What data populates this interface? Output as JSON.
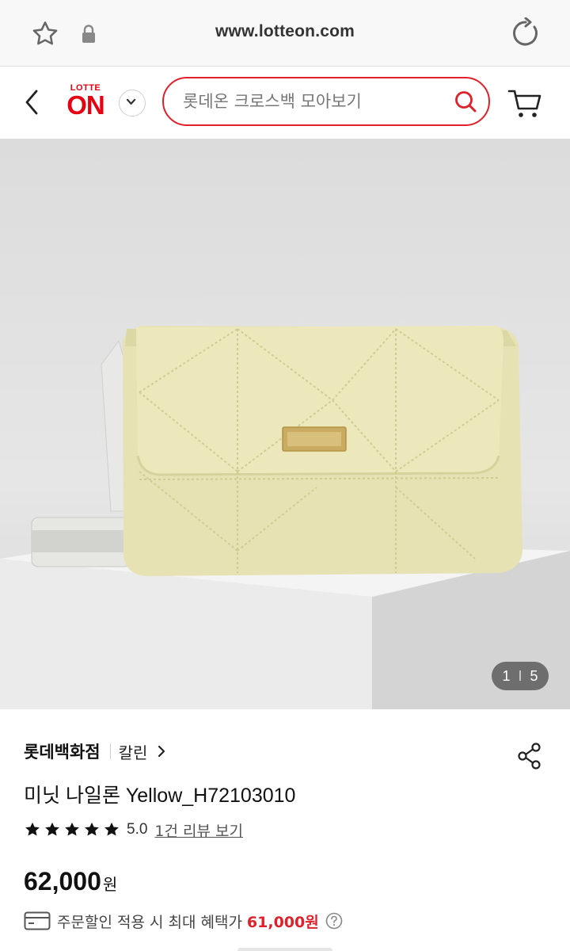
{
  "browser": {
    "url": "www.lotteon.com",
    "icons": [
      "star-icon",
      "lock-icon",
      "reload-icon"
    ]
  },
  "header": {
    "logo_top": "LOTTE",
    "logo_main": "ON",
    "search_placeholder": "롯데온 크로스백 모아보기",
    "accent_color": "#e0202a",
    "icons": [
      "back-icon",
      "chevron-down-icon",
      "search-icon",
      "cart-icon"
    ]
  },
  "product": {
    "image_counter": {
      "current": "1",
      "separator": "I",
      "total": "5"
    },
    "store_name": "롯데백화점",
    "brand_name": "칼린",
    "title": "미닛 나일론 Yellow_H72103010",
    "rating": {
      "stars": 5,
      "value": "5.0",
      "review_link": "1건 리뷰 보기"
    },
    "price": "62,000",
    "price_unit": "원",
    "benefit": {
      "text": "주문할인 적용 시 최대 혜택가",
      "price": "61,000원"
    }
  }
}
